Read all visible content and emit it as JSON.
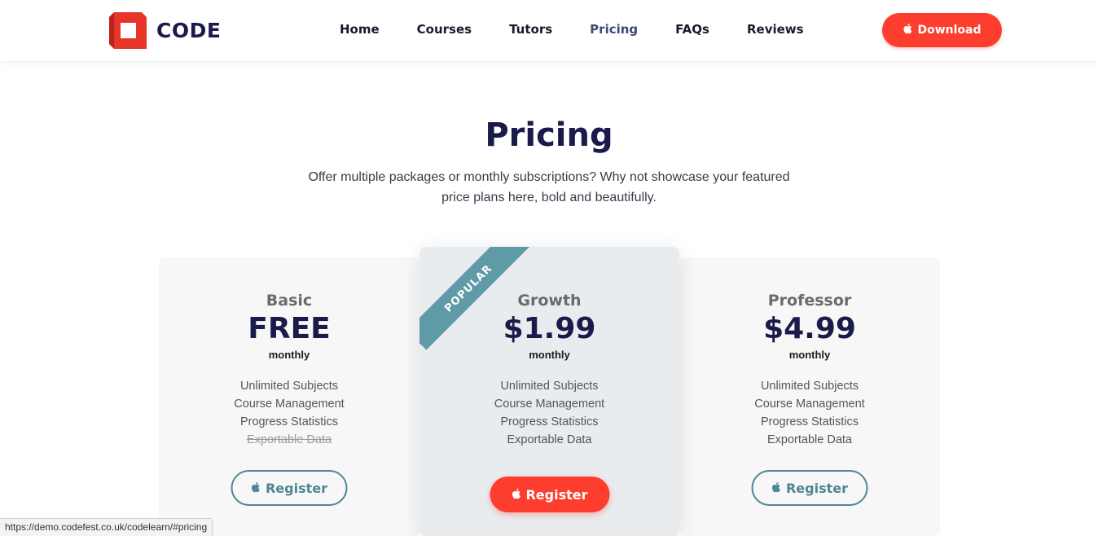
{
  "brand": {
    "name": "CODE",
    "accent": "#fd3d2e",
    "navy": "#1b1b4b",
    "teal": "#4e8597"
  },
  "nav": {
    "items": [
      {
        "label": "Home"
      },
      {
        "label": "Courses"
      },
      {
        "label": "Tutors"
      },
      {
        "label": "Pricing",
        "active": true
      },
      {
        "label": "FAQs"
      },
      {
        "label": "Reviews"
      }
    ],
    "download_label": "Download",
    "download_icon": "apple-icon"
  },
  "pricing": {
    "title": "Pricing",
    "subtitle_line1": "Offer multiple packages or monthly subscriptions? Why not showcase your featured",
    "subtitle_line2": "price plans here, bold and beautifully.",
    "plans": [
      {
        "name": "Basic",
        "price": "FREE",
        "period": "monthly",
        "features": [
          "Unlimited Subjects",
          "Course Management",
          "Progress Statistics",
          "Exportable Data"
        ],
        "struck_feature_index": 3,
        "button_label": "Register"
      },
      {
        "name": "Growth",
        "price": "$1.99",
        "period": "monthly",
        "ribbon": "POPULAR",
        "features": [
          "Unlimited Subjects",
          "Course Management",
          "Progress Statistics",
          "Exportable Data"
        ],
        "button_label": "Register"
      },
      {
        "name": "Professor",
        "price": "$4.99",
        "period": "monthly",
        "features": [
          "Unlimited Subjects",
          "Course Management",
          "Progress Statistics",
          "Exportable Data"
        ],
        "button_label": "Register"
      }
    ]
  },
  "status_bar": {
    "url": "https://demo.codefest.co.uk/codelearn/#pricing"
  }
}
